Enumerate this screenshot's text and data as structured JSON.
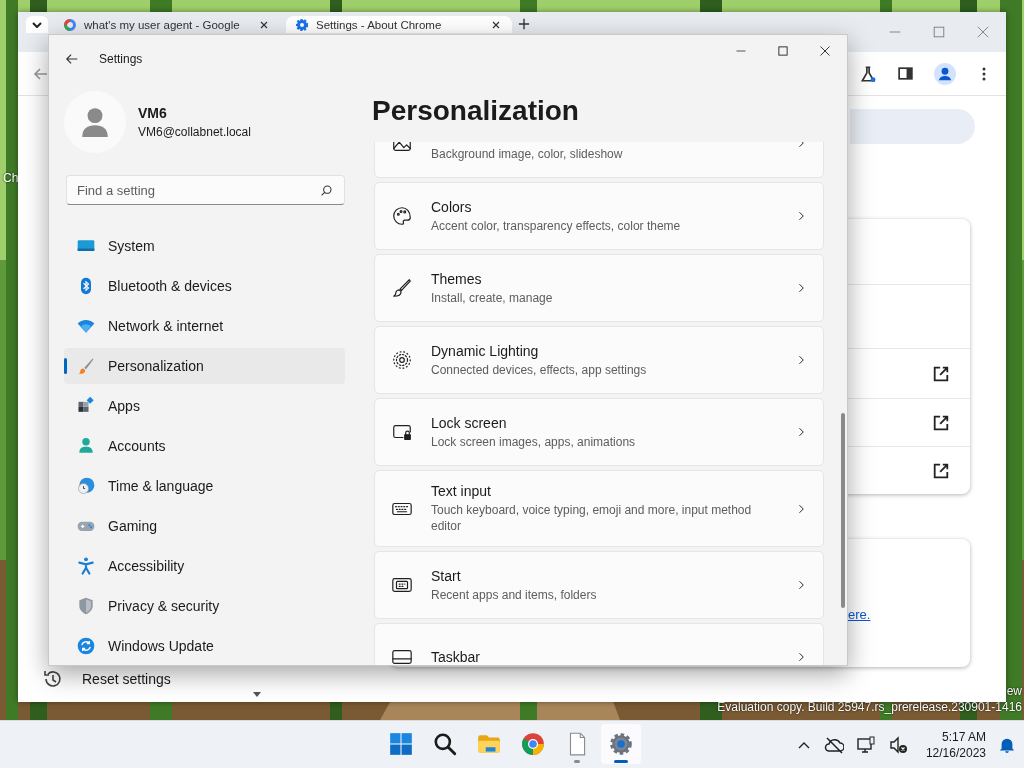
{
  "desktop": {
    "icon_label": "Ch",
    "watermark": [
      "ew",
      "Evaluation copy. Build 25947.rs_prerelease.230901-1416"
    ]
  },
  "browser": {
    "tabs": [
      {
        "title": "what's my user agent - Google",
        "kind": "google",
        "selected": false
      },
      {
        "title": "Settings - About Chrome",
        "kind": "gear",
        "selected": true
      }
    ],
    "nav_item": "Reset settings",
    "link": "ere."
  },
  "settings": {
    "title": "Settings",
    "user": {
      "name": "VM6",
      "email": "VM6@collabnet.local"
    },
    "search": {
      "placeholder": "Find a setting"
    },
    "nav": [
      {
        "label": "System",
        "kind": "system",
        "selected": false
      },
      {
        "label": "Bluetooth & devices",
        "kind": "bluetooth",
        "selected": false
      },
      {
        "label": "Network & internet",
        "kind": "network",
        "selected": false
      },
      {
        "label": "Personalization",
        "kind": "personalization",
        "selected": true
      },
      {
        "label": "Apps",
        "kind": "apps",
        "selected": false
      },
      {
        "label": "Accounts",
        "kind": "accounts",
        "selected": false
      },
      {
        "label": "Time & language",
        "kind": "time",
        "selected": false
      },
      {
        "label": "Gaming",
        "kind": "gaming",
        "selected": false
      },
      {
        "label": "Accessibility",
        "kind": "accessibility",
        "selected": false
      },
      {
        "label": "Privacy & security",
        "kind": "privacy",
        "selected": false
      },
      {
        "label": "Windows Update",
        "kind": "update",
        "selected": false
      }
    ],
    "page_title": "Personalization",
    "items": [
      {
        "subtitle": "Background image, color, slideshow"
      },
      {
        "kind": "palette",
        "title": "Colors",
        "subtitle": "Accent color, transparency effects, color theme"
      },
      {
        "kind": "brush",
        "title": "Themes",
        "subtitle": "Install, create, manage"
      },
      {
        "kind": "lighting",
        "title": "Dynamic Lighting",
        "subtitle": "Connected devices, effects, app settings"
      },
      {
        "kind": "lock",
        "title": "Lock screen",
        "subtitle": "Lock screen images, apps, animations"
      },
      {
        "kind": "keyboard",
        "title": "Text input",
        "subtitle": "Touch keyboard, voice typing, emoji and more, input method editor"
      },
      {
        "kind": "start",
        "title": "Start",
        "subtitle": "Recent apps and items, folders"
      },
      {
        "kind": "taskbar",
        "title": "Taskbar"
      }
    ]
  },
  "taskbar": {
    "apps": [
      {
        "kind": "start",
        "running": false,
        "selected": false
      },
      {
        "kind": "search",
        "running": false,
        "selected": false
      },
      {
        "kind": "folder",
        "running": false,
        "selected": false
      },
      {
        "kind": "chrome",
        "running": false,
        "selected": false
      },
      {
        "kind": "notepad",
        "running": true,
        "selected": false
      },
      {
        "kind": "settings",
        "running": true,
        "selected": true
      }
    ],
    "clock": {
      "time": "5:17 AM",
      "date": "12/16/2023"
    }
  }
}
